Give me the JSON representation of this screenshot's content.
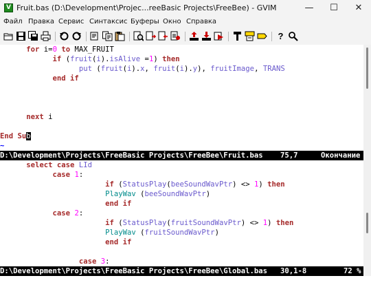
{
  "window": {
    "title": "Fruit.bas (D:\\Development\\Projec...reeBasic Projects\\FreeBee) - GVIM",
    "icon_label": "V",
    "minimize_glyph": "—",
    "maximize_glyph": "☐",
    "close_glyph": "✕"
  },
  "menu": [
    "Файл",
    "Правка",
    "Сервис",
    "Синтаксис",
    "Буферы",
    "Окно",
    "Справка"
  ],
  "toolbar": {
    "buttons": [
      "open-icon",
      "save-icon",
      "save-all-icon",
      "print-icon",
      "undo-icon",
      "redo-icon",
      "cut-icon",
      "copy-icon",
      "paste-icon",
      "find-replace-icon",
      "find-next-icon",
      "find-prev-icon",
      "load-session-icon",
      "save-session-icon",
      "run-script-icon",
      "make-icon",
      "build-tags-icon",
      "jump-tag-icon",
      "help-icon",
      "find-help-icon"
    ],
    "help_glyph": "?"
  },
  "top_window": {
    "lines": [
      [
        {
          "t": "      "
        },
        {
          "t": "for",
          "c": "k"
        },
        {
          "t": " i="
        },
        {
          "t": "0",
          "c": "n"
        },
        {
          "t": " "
        },
        {
          "t": "to",
          "c": "k"
        },
        {
          "t": " MAX_FRUIT"
        }
      ],
      [
        {
          "t": "            "
        },
        {
          "t": "if",
          "c": "k"
        },
        {
          "t": " ("
        },
        {
          "t": "fruit",
          "c": "c"
        },
        {
          "t": "("
        },
        {
          "t": "i",
          "c": "c"
        },
        {
          "t": ")."
        },
        {
          "t": "isAlive",
          "c": "c"
        },
        {
          "t": " ="
        },
        {
          "t": "1",
          "c": "n"
        },
        {
          "t": ") "
        },
        {
          "t": "then",
          "c": "k"
        }
      ],
      [
        {
          "t": "                  "
        },
        {
          "t": "put",
          "c": "c"
        },
        {
          "t": " ("
        },
        {
          "t": "fruit",
          "c": "c"
        },
        {
          "t": "("
        },
        {
          "t": "i",
          "c": "c"
        },
        {
          "t": ")."
        },
        {
          "t": "x",
          "c": "c"
        },
        {
          "t": ", "
        },
        {
          "t": "fruit",
          "c": "c"
        },
        {
          "t": "("
        },
        {
          "t": "i",
          "c": "c"
        },
        {
          "t": ")."
        },
        {
          "t": "y",
          "c": "c"
        },
        {
          "t": "), "
        },
        {
          "t": "fruitImage",
          "c": "c"
        },
        {
          "t": ", "
        },
        {
          "t": "TRANS",
          "c": "c"
        }
      ],
      [
        {
          "t": "            "
        },
        {
          "t": "end if",
          "c": "k"
        }
      ],
      [],
      [],
      [],
      [
        {
          "t": "      "
        },
        {
          "t": "next",
          "c": "k"
        },
        {
          "t": " i"
        }
      ],
      [],
      [
        {
          "t": "End Su",
          "c": "k"
        },
        {
          "t": "b",
          "c": "cursor"
        }
      ],
      [
        {
          "t": "~",
          "c": "tilde"
        }
      ]
    ]
  },
  "top_status": {
    "path": "D:\\Development\\Projects\\FreeBasic Projects\\FreeBee\\Fruit.bas",
    "position": "75,7",
    "scroll": "Окончание"
  },
  "bottom_window": {
    "lines": [
      [
        {
          "t": "      "
        },
        {
          "t": "select case",
          "c": "k"
        },
        {
          "t": " "
        },
        {
          "t": "LId",
          "c": "c"
        }
      ],
      [
        {
          "t": "            "
        },
        {
          "t": "case",
          "c": "k"
        },
        {
          "t": " "
        },
        {
          "t": "1",
          "c": "n"
        },
        {
          "t": ":"
        }
      ],
      [
        {
          "t": "                        "
        },
        {
          "t": "if",
          "c": "k"
        },
        {
          "t": " ("
        },
        {
          "t": "StatusPlay",
          "c": "c"
        },
        {
          "t": "("
        },
        {
          "t": "beeSoundWavPtr",
          "c": "c"
        },
        {
          "t": ") <> "
        },
        {
          "t": "1",
          "c": "n"
        },
        {
          "t": ") "
        },
        {
          "t": "then",
          "c": "k"
        }
      ],
      [
        {
          "t": "                        "
        },
        {
          "t": "PlayWav",
          "c": "t"
        },
        {
          "t": " ("
        },
        {
          "t": "beeSoundWavPtr",
          "c": "c"
        },
        {
          "t": ")"
        }
      ],
      [
        {
          "t": "                        "
        },
        {
          "t": "end if",
          "c": "k"
        }
      ],
      [
        {
          "t": "            "
        },
        {
          "t": "case",
          "c": "k"
        },
        {
          "t": " "
        },
        {
          "t": "2",
          "c": "n"
        },
        {
          "t": ":"
        }
      ],
      [
        {
          "t": "                        "
        },
        {
          "t": "if",
          "c": "k"
        },
        {
          "t": " ("
        },
        {
          "t": "StatusPlay",
          "c": "c"
        },
        {
          "t": "("
        },
        {
          "t": "fruitSoundWavPtr",
          "c": "c"
        },
        {
          "t": ") <> "
        },
        {
          "t": "1",
          "c": "n"
        },
        {
          "t": ") "
        },
        {
          "t": "then",
          "c": "k"
        }
      ],
      [
        {
          "t": "                        "
        },
        {
          "t": "PlayWav",
          "c": "t"
        },
        {
          "t": " ("
        },
        {
          "t": "fruitSoundWavPtr",
          "c": "c"
        },
        {
          "t": ")"
        }
      ],
      [
        {
          "t": "                        "
        },
        {
          "t": "end if",
          "c": "k"
        }
      ],
      [],
      [
        {
          "t": "                  "
        },
        {
          "t": "case",
          "c": "k"
        },
        {
          "t": " "
        },
        {
          "t": "3",
          "c": "n"
        },
        {
          "t": ":"
        }
      ]
    ]
  },
  "bottom_status": {
    "path": "D:\\Development\\Projects\\FreeBasic Projects\\FreeBee\\Global.bas",
    "position": "30,1-8",
    "scroll": "72 %"
  },
  "colors": {
    "keyword": "#a52a2a",
    "identifier": "#6a5acd",
    "number": "#ff00ff",
    "function": "#008b8b",
    "status_bg": "#000000",
    "tilde": "#0000ff"
  }
}
